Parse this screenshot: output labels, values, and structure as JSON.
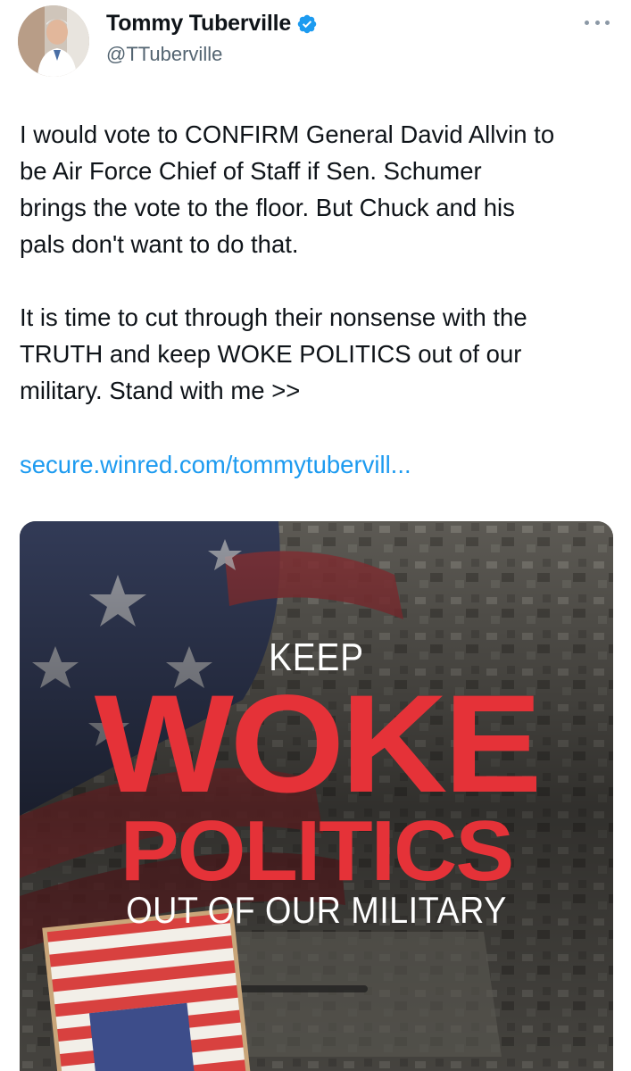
{
  "author": {
    "display_name": "Tommy Tuberville",
    "handle": "@TTuberville",
    "verified": true,
    "avatar_icon": "profile-photo"
  },
  "menu_icon": "more-horizontal-icon",
  "tweet": {
    "text": "I would vote to CONFIRM General David Allvin to\nbe Air Force Chief of Staff if Sen. Schumer\nbrings the vote to the floor. But Chuck and his\npals don't want to do that.\n\nIt is time to cut through their nonsense with the\nTRUTH and keep WOKE POLITICS out of our\nmilitary. Stand with me >>",
    "link": "secure.winred.com/tommytubervill..."
  },
  "media": {
    "line1": "KEEP",
    "line2": "WOKE",
    "line3": "POLITICS",
    "line4": "OUT OF OUR MILITARY"
  },
  "colors": {
    "link": "#1d9bf0",
    "verified": "#1d9bf0",
    "headline_red": "#e53238",
    "secondary_text": "#536471"
  }
}
